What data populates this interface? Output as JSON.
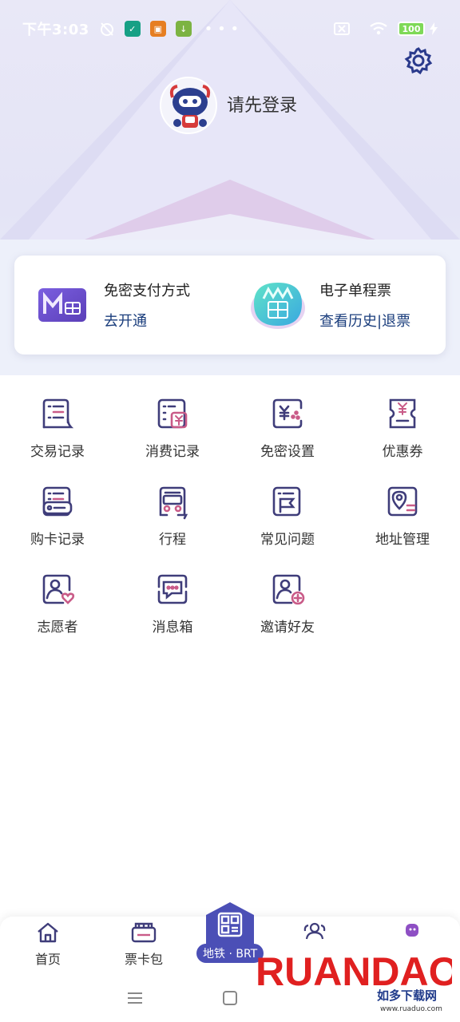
{
  "status_bar": {
    "time": "下午3:03",
    "battery": "100"
  },
  "profile": {
    "login_prompt": "请先登录"
  },
  "card": {
    "left": {
      "title": "免密支付方式",
      "link": "去开通"
    },
    "right": {
      "title": "电子单程票",
      "link": "查看历史|退票"
    }
  },
  "grid": {
    "items": [
      {
        "label": "交易记录",
        "icon": "transaction-record-icon"
      },
      {
        "label": "消费记录",
        "icon": "consumption-record-icon"
      },
      {
        "label": "免密设置",
        "icon": "password-free-icon"
      },
      {
        "label": "优惠券",
        "icon": "coupon-icon"
      },
      {
        "label": "购卡记录",
        "icon": "card-purchase-icon"
      },
      {
        "label": "行程",
        "icon": "trip-icon"
      },
      {
        "label": "常见问题",
        "icon": "faq-icon"
      },
      {
        "label": "地址管理",
        "icon": "address-icon"
      },
      {
        "label": "志愿者",
        "icon": "volunteer-icon"
      },
      {
        "label": "消息箱",
        "icon": "message-box-icon"
      },
      {
        "label": "邀请好友",
        "icon": "invite-friend-icon"
      }
    ]
  },
  "nav": {
    "home": "首页",
    "tickets": "票卡包",
    "metro": "地铁 · BRT"
  },
  "watermark": {
    "brand": "RUANDAO",
    "cn": "如多下载网",
    "url": "www.ruaduo.com"
  },
  "colors": {
    "accent": "#4b4fb6",
    "icon_stroke": "#3f3d7a",
    "icon_accent": "#c95b88",
    "link": "#1a3d7c"
  }
}
